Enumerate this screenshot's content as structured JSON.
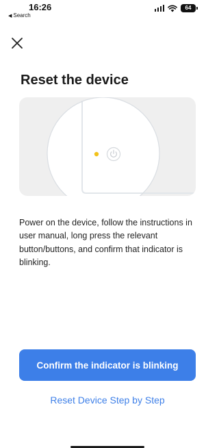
{
  "status_bar": {
    "time": "16:26",
    "back_app": "Search",
    "battery_level": "64"
  },
  "header": {
    "close_icon": "close-icon"
  },
  "page": {
    "title": "Reset the device",
    "description": "Power on the device, follow the instructions in user manual, long press the relevant button/buttons, and confirm that indicator is blinking."
  },
  "illustration": {
    "icons": [
      "indicator-light-icon",
      "power-button-icon"
    ],
    "indicator_color": "#f2c21b"
  },
  "actions": {
    "primary_label": "Confirm the indicator is blinking",
    "secondary_label": "Reset Device Step by Step"
  },
  "colors": {
    "accent": "#3d7fe8",
    "illustration_bg": "#efefef"
  }
}
